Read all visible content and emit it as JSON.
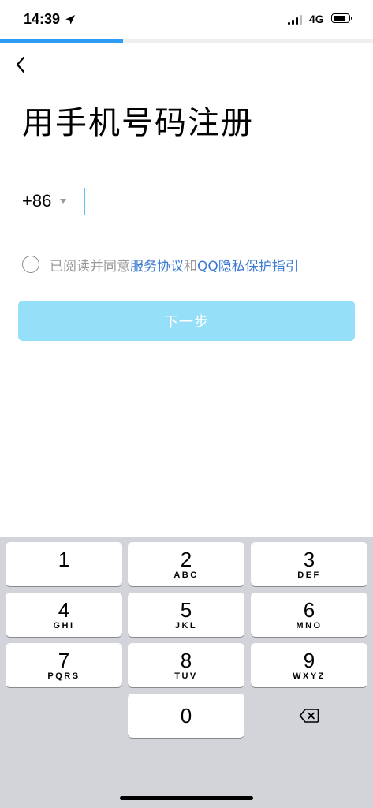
{
  "status_bar": {
    "time": "14:39",
    "network": "4G"
  },
  "progress": {
    "fraction": 0.33,
    "color": "#2f9bf7"
  },
  "page": {
    "title": "用手机号码注册"
  },
  "phone": {
    "country_code": "+86",
    "number": ""
  },
  "agreement": {
    "prefix": "已阅读并同意",
    "terms_link": "服务协议",
    "conjunction": "和",
    "privacy_link": "QQ隐私保护指引"
  },
  "next_button": {
    "label": "下一步",
    "color": "#95dff8"
  },
  "keyboard": {
    "keys": [
      {
        "digit": "1",
        "letters": ""
      },
      {
        "digit": "2",
        "letters": "ABC"
      },
      {
        "digit": "3",
        "letters": "DEF"
      },
      {
        "digit": "4",
        "letters": "GHI"
      },
      {
        "digit": "5",
        "letters": "JKL"
      },
      {
        "digit": "6",
        "letters": "MNO"
      },
      {
        "digit": "7",
        "letters": "PQRS"
      },
      {
        "digit": "8",
        "letters": "TUV"
      },
      {
        "digit": "9",
        "letters": "WXYZ"
      },
      {
        "digit": "0",
        "letters": ""
      }
    ],
    "delete_icon": "delete-backspace-icon"
  },
  "colors": {
    "link": "#3d7bd3",
    "keyboard_bg": "#d2d4da"
  }
}
